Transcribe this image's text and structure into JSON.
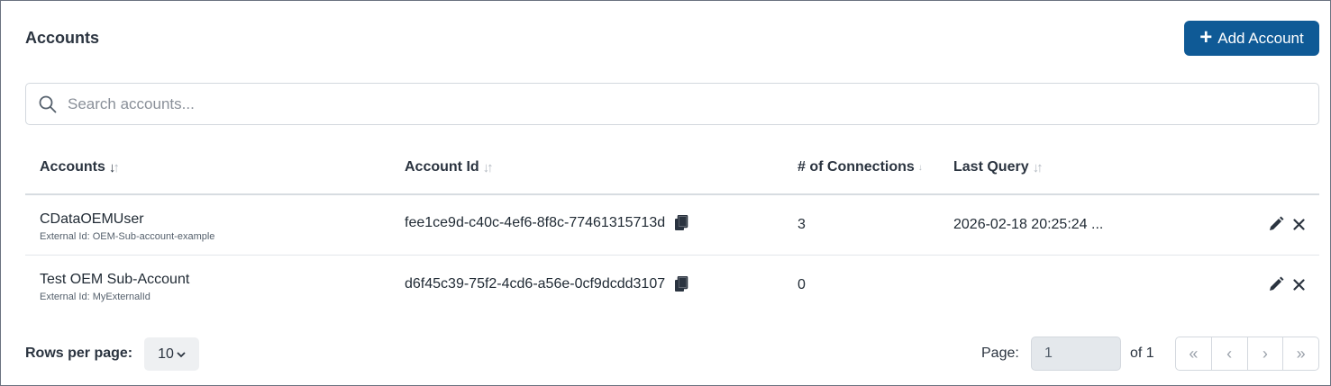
{
  "header": {
    "title": "Accounts",
    "add_button_label": "Add Account",
    "add_icon": "plus-icon"
  },
  "search": {
    "placeholder": "Search accounts...",
    "value": ""
  },
  "table": {
    "columns": [
      {
        "label": "Accounts",
        "sort": "descending"
      },
      {
        "label": "Account Id",
        "sort": "none"
      },
      {
        "label": "# of Connections",
        "sort": "none"
      },
      {
        "label": "Last Query",
        "sort": "none"
      }
    ],
    "rows": [
      {
        "name": "CDataOEMUser",
        "external_id": "External Id: OEM-Sub-account-example",
        "account_id": "fee1ce9d-c40c-4ef6-8f8c-77461315713d",
        "connections": "3",
        "last_query": "2026-02-18 20:25:24 ..."
      },
      {
        "name": "Test OEM Sub-Account",
        "external_id": "External Id: MyExternalId",
        "account_id": "d6f45c39-75f2-4cd6-a56e-0cf9dcdd3107",
        "connections": "0",
        "last_query": ""
      }
    ]
  },
  "footer": {
    "rows_per_page_label": "Rows per page:",
    "rows_per_page_value": "10",
    "page_label": "Page:",
    "page_value": "1",
    "page_of": "of 1"
  },
  "colors": {
    "accent": "#0f5a96",
    "border": "#d3d8de"
  }
}
